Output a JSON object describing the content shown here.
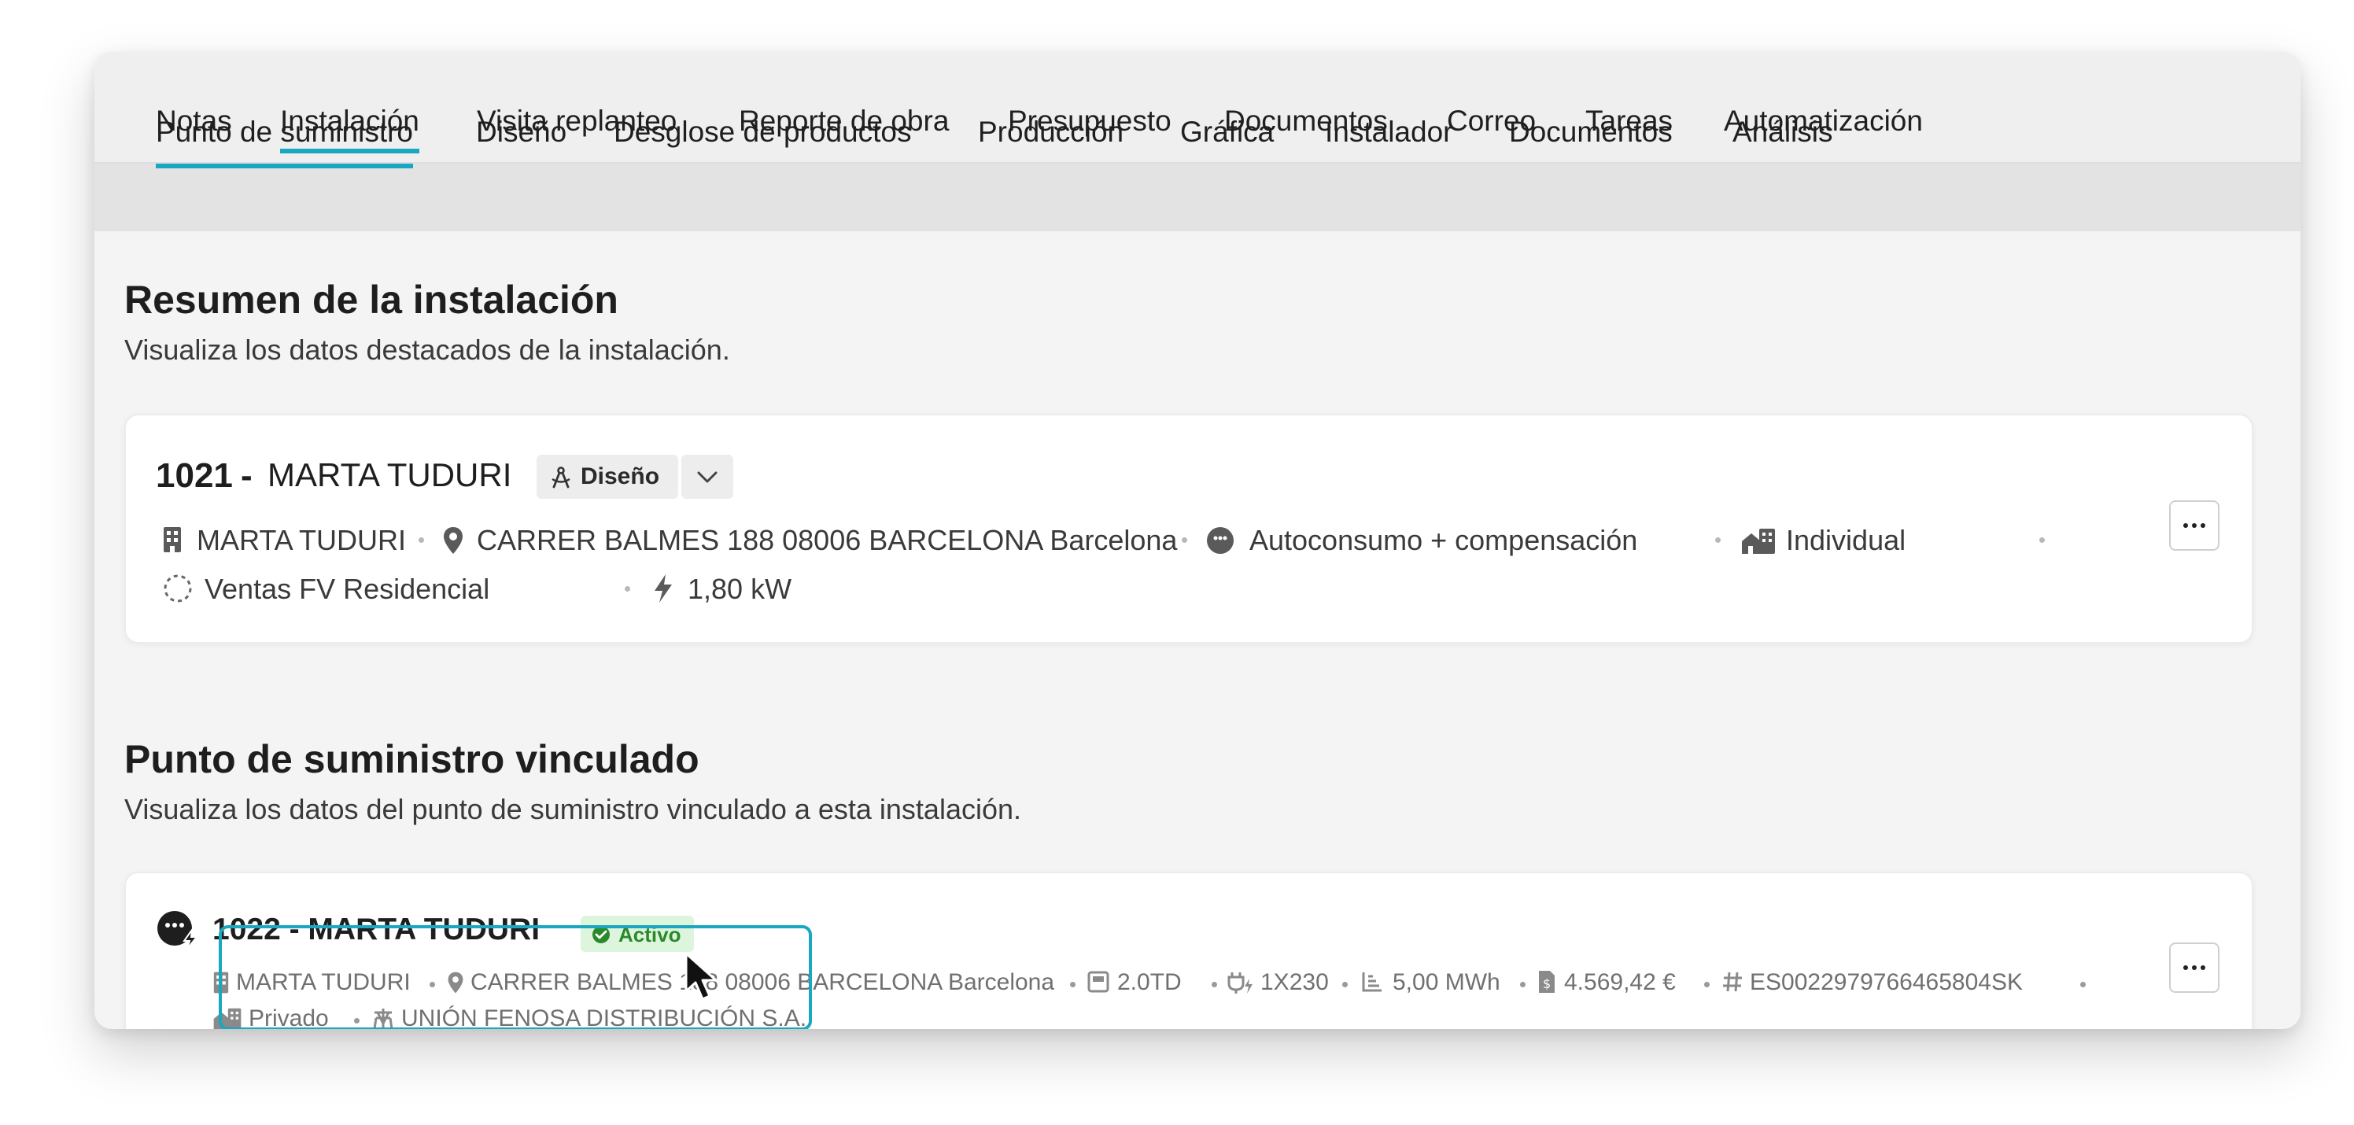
{
  "tabs_primary": [
    "Notas",
    "Instalación",
    "Visita replanteo",
    "Reporte de obra",
    "Presupuesto",
    "Documentos",
    "Correo",
    "Tareas",
    "Automatización"
  ],
  "tabs_secondary": [
    "Punto de suministro",
    "Diseño",
    "Desglose de productos",
    "Producción",
    "Gráfica",
    "Instalador",
    "Documentos",
    "Análisis"
  ],
  "active_primary_tab": "Instalación",
  "active_secondary_tab": "Punto de suministro",
  "summary": {
    "title": "Resumen de la instalación",
    "subtitle": "Visualiza los datos destacados de la instalación.",
    "card": {
      "id": "1021",
      "separator": "-",
      "name": "MARTA TUDURI",
      "stage_chip": "Diseño",
      "meta": {
        "client": "MARTA TUDURI",
        "address": "CARRER BALMES 188 08006 BARCELONA Barcelona",
        "mode": "Autoconsumo + compensación",
        "type": "Individual",
        "pipeline": "Ventas FV Residencial",
        "power": "1,80 kW"
      }
    }
  },
  "supply": {
    "title": "Punto de suministro vinculado",
    "subtitle": "Visualiza los datos del punto de suministro vinculado a esta instalación.",
    "card": {
      "heading": "1022 - MARTA TUDURI",
      "status_badge": "Activo",
      "meta": {
        "client": "MARTA TUDURI",
        "address": "CARRER BALMES 188 08006 BARCELONA Barcelona",
        "tariff": "2.0TD",
        "connection": "1X230",
        "consumption": "5,00 MWh",
        "cost": "4.569,42 €",
        "cups": "ES0022979766465804SK",
        "ownership": "Privado",
        "distributor": "UNIÓN FENOSA DISTRIBUCIÓN S.A."
      }
    }
  },
  "colors": {
    "accent": "#1aa7c0",
    "active_badge_bg": "#dcf5dc",
    "active_badge_text": "#2a8a2a"
  },
  "icons": [
    "building-icon",
    "location-pin-icon",
    "plug-solar-icon",
    "house-building-icon",
    "dashed-circle-icon",
    "bolt-icon",
    "compass-icon",
    "chevron-down-icon",
    "more-icon",
    "meter-icon",
    "plug-icon",
    "chart-icon",
    "receipt-icon",
    "hash-icon",
    "tower-icon",
    "check-circle-icon",
    "cursor-icon"
  ]
}
